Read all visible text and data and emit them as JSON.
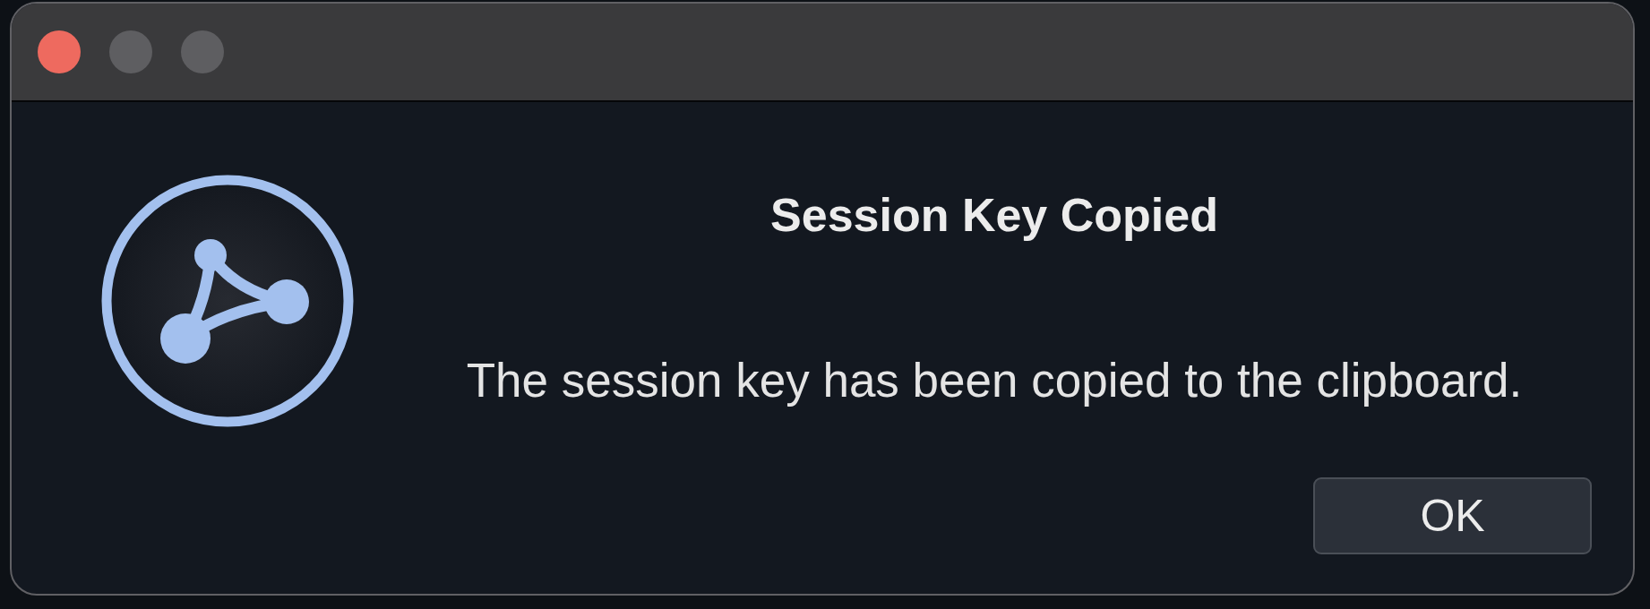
{
  "window": {
    "controls": [
      {
        "kind": "close",
        "disabled": false
      },
      {
        "kind": "minimize",
        "disabled": true
      },
      {
        "kind": "zoom",
        "disabled": true
      }
    ]
  },
  "dialog": {
    "title": "Session Key Copied",
    "message": "The session key has been copied to the clipboard.",
    "buttons": [
      {
        "label": "OK"
      }
    ]
  }
}
